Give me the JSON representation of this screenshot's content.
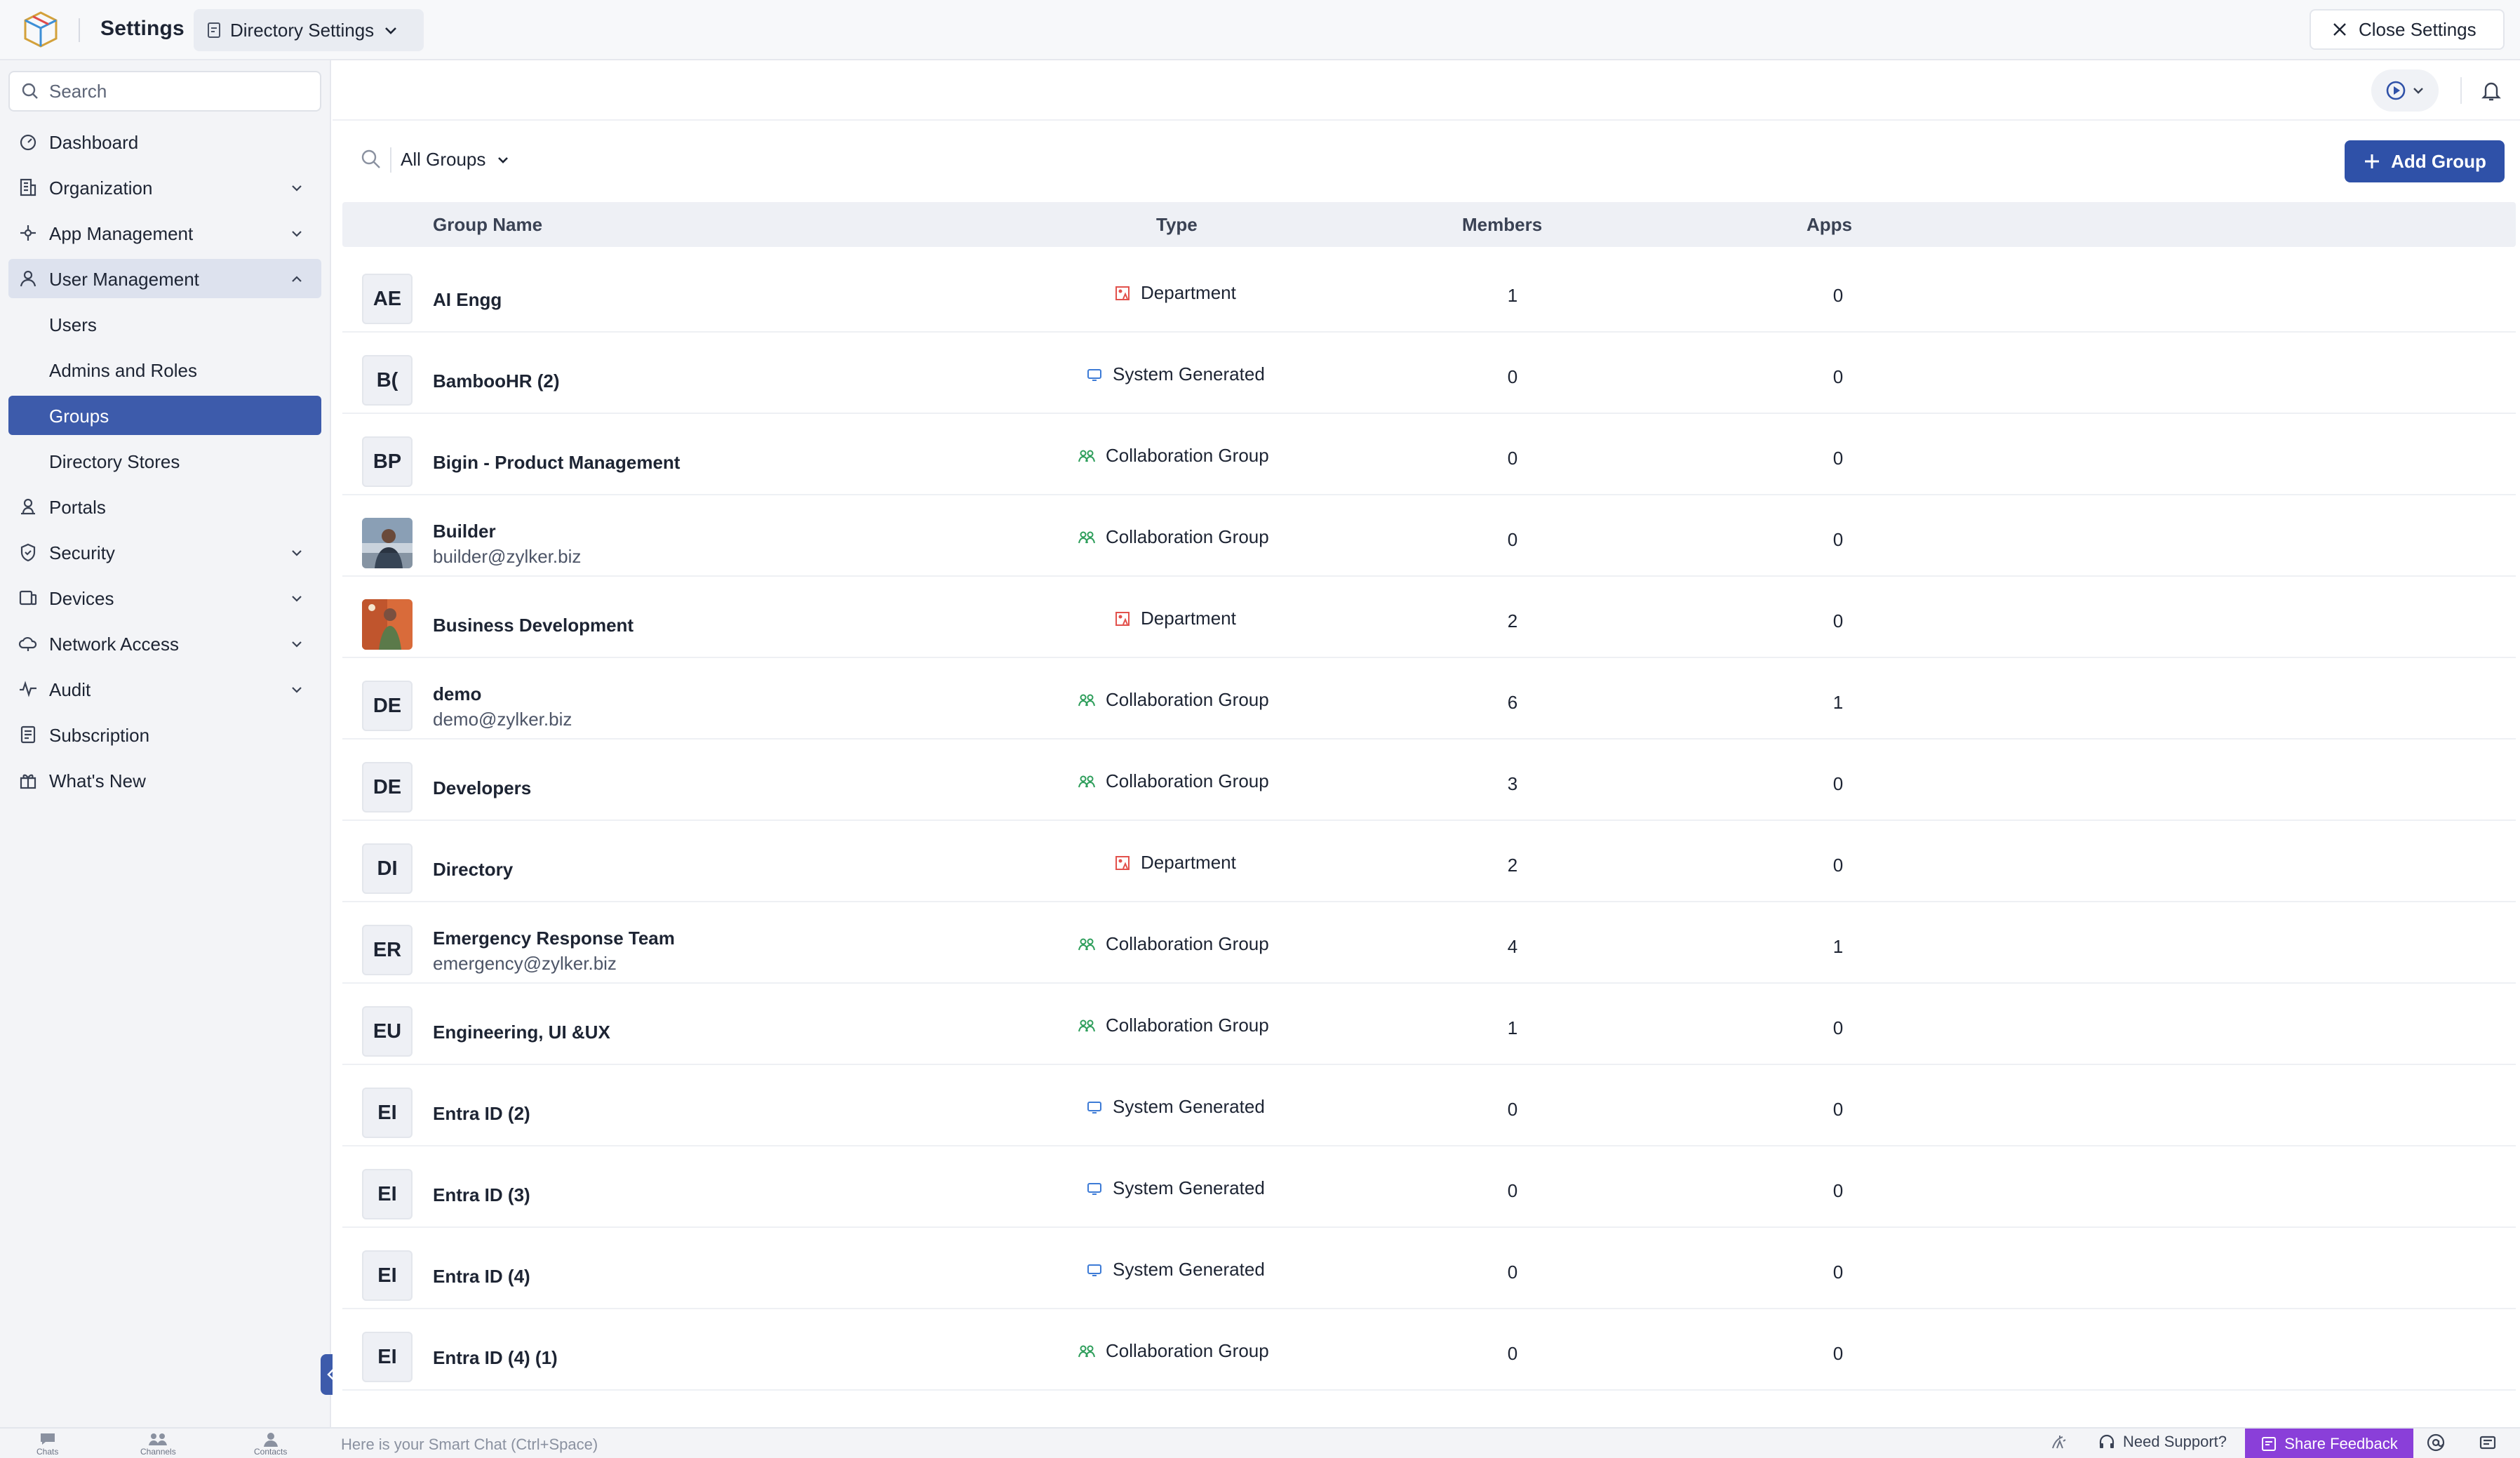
{
  "header": {
    "app_title": "Settings",
    "section_dropdown": "Directory Settings",
    "close_label": "Close Settings"
  },
  "sidebar": {
    "search_placeholder": "Search",
    "items": [
      {
        "label": "Dashboard",
        "icon": "gauge-icon"
      },
      {
        "label": "Organization",
        "icon": "building-icon"
      },
      {
        "label": "App Management",
        "icon": "apps-icon"
      },
      {
        "label": "User Management",
        "icon": "user-icon"
      },
      {
        "label": "Users"
      },
      {
        "label": "Admins and Roles"
      },
      {
        "label": "Groups"
      },
      {
        "label": "Directory Stores"
      },
      {
        "label": "Portals",
        "icon": "portal-icon"
      },
      {
        "label": "Security",
        "icon": "shield-icon"
      },
      {
        "label": "Devices",
        "icon": "device-icon"
      },
      {
        "label": "Network Access",
        "icon": "cloud-icon"
      },
      {
        "label": "Audit",
        "icon": "pulse-icon"
      },
      {
        "label": "Subscription",
        "icon": "receipt-icon"
      },
      {
        "label": "What's New",
        "icon": "gift-icon"
      }
    ]
  },
  "toolbar": {
    "filter_label": "All Groups",
    "add_label": "Add Group"
  },
  "table": {
    "columns": [
      "Group Name",
      "Type",
      "Members",
      "Apps"
    ],
    "rows": [
      {
        "initials": "AE",
        "name": "AI Engg",
        "email": "",
        "type": "Department",
        "members": "1",
        "apps": "0"
      },
      {
        "initials": "B(",
        "name": "BambooHR (2)",
        "email": "",
        "type": "System Generated",
        "members": "0",
        "apps": "0"
      },
      {
        "initials": "BP",
        "name": "Bigin - Product Management",
        "email": "",
        "type": "Collaboration Group",
        "members": "0",
        "apps": "0"
      },
      {
        "initials": "",
        "name": "Builder",
        "email": "builder@zylker.biz",
        "type": "Collaboration Group",
        "members": "0",
        "apps": "0"
      },
      {
        "initials": "",
        "name": "Business Development",
        "email": "",
        "type": "Department",
        "members": "2",
        "apps": "0"
      },
      {
        "initials": "DE",
        "name": "demo",
        "email": "demo@zylker.biz",
        "type": "Collaboration Group",
        "members": "6",
        "apps": "1"
      },
      {
        "initials": "DE",
        "name": "Developers",
        "email": "",
        "type": "Collaboration Group",
        "members": "3",
        "apps": "0"
      },
      {
        "initials": "DI",
        "name": "Directory",
        "email": "",
        "type": "Department",
        "members": "2",
        "apps": "0"
      },
      {
        "initials": "ER",
        "name": "Emergency Response Team",
        "email": "emergency@zylker.biz",
        "type": "Collaboration Group",
        "members": "4",
        "apps": "1"
      },
      {
        "initials": "EU",
        "name": "Engineering, UI &UX",
        "email": "",
        "type": "Collaboration Group",
        "members": "1",
        "apps": "0"
      },
      {
        "initials": "EI",
        "name": "Entra ID (2)",
        "email": "",
        "type": "System Generated",
        "members": "0",
        "apps": "0"
      },
      {
        "initials": "EI",
        "name": "Entra ID (3)",
        "email": "",
        "type": "System Generated",
        "members": "0",
        "apps": "0"
      },
      {
        "initials": "EI",
        "name": "Entra ID (4)",
        "email": "",
        "type": "System Generated",
        "members": "0",
        "apps": "0"
      },
      {
        "initials": "EI",
        "name": "Entra ID (4) (1)",
        "email": "",
        "type": "Collaboration Group",
        "members": "0",
        "apps": "0"
      }
    ]
  },
  "bottombar": {
    "tabs": [
      "Chats",
      "Channels",
      "Contacts"
    ],
    "chat_placeholder": "Here is your Smart Chat (Ctrl+Space)",
    "support_label": "Need Support?",
    "feedback_label": "Share Feedback"
  },
  "colors": {
    "accent": "#2f51a8",
    "active_nav": "#3d5bab",
    "feedback": "#8a3fd9"
  }
}
